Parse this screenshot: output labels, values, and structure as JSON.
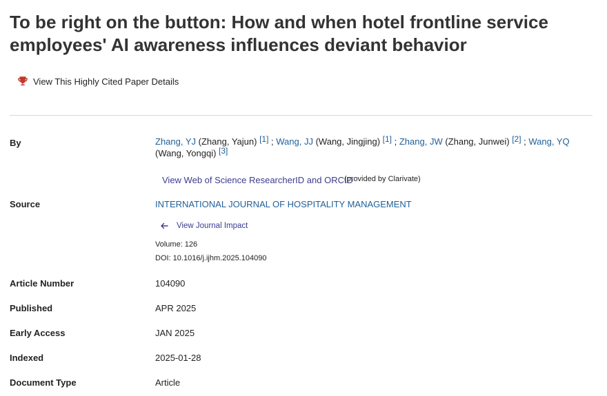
{
  "title": "To be right on the button: How and when hotel frontline service employees' AI awareness influences deviant behavior",
  "highly_cited_label": "View This Highly Cited Paper Details",
  "fields": {
    "by_label": "By",
    "source_label": "Source",
    "article_number_label": "Article Number",
    "published_label": "Published",
    "early_access_label": "Early Access",
    "indexed_label": "Indexed",
    "document_type_label": "Document Type"
  },
  "authors": [
    {
      "short": "Zhang, YJ",
      "full": "(Zhang, Yajun)",
      "ref": "[1]"
    },
    {
      "short": "Wang, JJ",
      "full": "(Wang, Jingjing)",
      "ref": "[1]"
    },
    {
      "short": "Zhang, JW",
      "full": "(Zhang, Junwei)",
      "ref": "[2]"
    },
    {
      "short": "Wang, YQ",
      "full": "(Wang, Yongqi)",
      "ref": "[3]"
    }
  ],
  "researcher_link": "View Web of Science ResearcherID and ORCID",
  "provided_by": "(provided by Clarivate)",
  "source": {
    "journal": "INTERNATIONAL JOURNAL OF HOSPITALITY MANAGEMENT",
    "journal_impact_link": "View Journal Impact",
    "volume": "Volume: 126",
    "doi": "DOI: 10.1016/j.ijhm.2025.104090"
  },
  "values": {
    "article_number": "104090",
    "published": "APR 2025",
    "early_access": "JAN 2025",
    "indexed": "2025-01-28",
    "document_type": "Article"
  },
  "colors": {
    "link": "#1f5f99",
    "secondary_link": "#3b3b8f",
    "trophy": "#c0392b"
  },
  "icons": [
    "trophy-icon",
    "arrow-left-icon"
  ]
}
